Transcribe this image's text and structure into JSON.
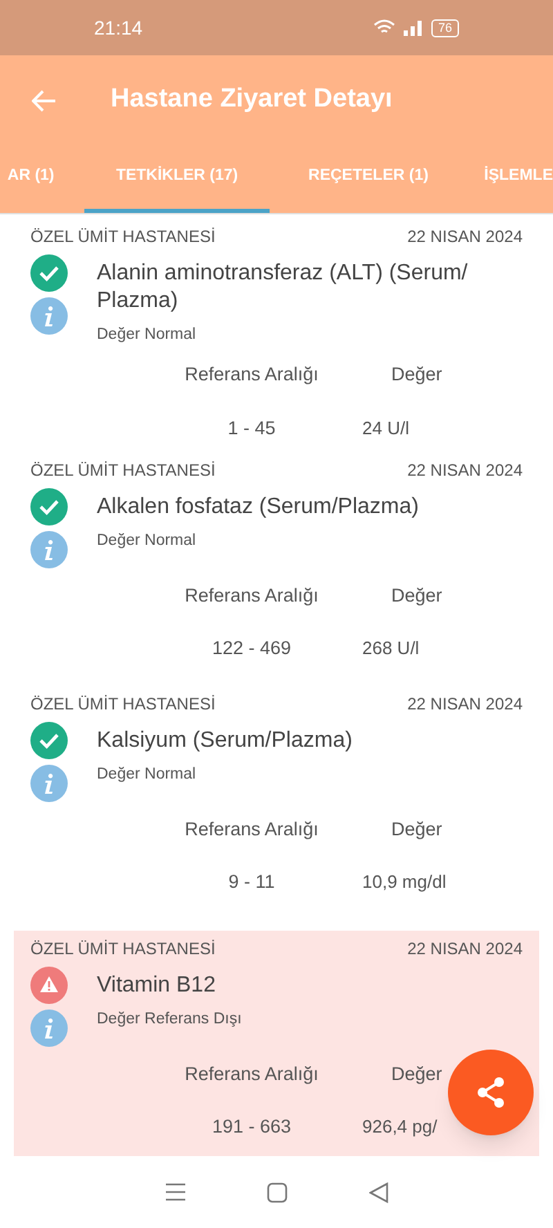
{
  "status_bar": {
    "time": "21:14",
    "battery": "76"
  },
  "app_bar": {
    "title": "Hastane Ziyaret Detayı"
  },
  "tabs": [
    {
      "label": "AR (1)",
      "selected": false
    },
    {
      "label": "TETKİKLER (17)",
      "selected": true
    },
    {
      "label": "REÇETELER (1)",
      "selected": false
    },
    {
      "label": "İŞLEMLE",
      "selected": false
    }
  ],
  "tests": [
    {
      "hospital": "ÖZEL ÜMİT HASTANESİ",
      "date": "22 NISAN 2024",
      "name": "Alanin aminotransferaz (ALT) (Serum/ Plazma)",
      "kind": "normal",
      "status": "Değer Normal",
      "range_label": "Referans Aralığı",
      "value_label": "Değer",
      "range": "1 - 45",
      "value": "24 U/l"
    },
    {
      "hospital": "ÖZEL ÜMİT HASTANESİ",
      "date": "22 NISAN 2024",
      "name": "Alkalen fosfataz (Serum/Plazma)",
      "kind": "normal",
      "status": "Değer Normal",
      "range_label": "Referans Aralığı",
      "value_label": "Değer",
      "range": "122 - 469",
      "value": "268 U/l"
    },
    {
      "hospital": "ÖZEL ÜMİT HASTANESİ",
      "date": "22 NISAN 2024",
      "name": "Kalsiyum (Serum/Plazma)",
      "kind": "normal",
      "status": "Değer Normal",
      "range_label": "Referans Aralığı",
      "value_label": "Değer",
      "range": "9 - 11",
      "value": "10,9 mg/dl"
    },
    {
      "hospital": "ÖZEL ÜMİT HASTANESİ",
      "date": "22 NISAN 2024",
      "name": "Vitamin B12",
      "kind": "out_of_range",
      "status": "Değer Referans Dışı",
      "range_label": "Referans Aralığı",
      "value_label": "Değer",
      "range": "191 - 663",
      "value": "926,4 pg/"
    }
  ]
}
